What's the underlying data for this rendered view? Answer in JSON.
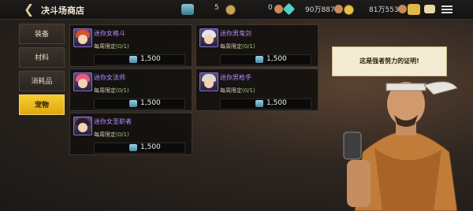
{
  "header": {
    "title": "决斗场商店"
  },
  "currencies": [
    {
      "amount": "5",
      "icon": "ticket-icon"
    },
    {
      "amount": "0",
      "icon": "gear-coin-icon"
    },
    {
      "amount": "90万8874",
      "icon": "gem-icon"
    },
    {
      "amount": "81万5530",
      "icon": "gold-coin-icon"
    }
  ],
  "sidebar": {
    "items": [
      {
        "label": "装备"
      },
      {
        "label": "材料"
      },
      {
        "label": "消耗品"
      },
      {
        "label": "宠物"
      }
    ],
    "active": 3
  },
  "items": [
    {
      "name": "迷你女格斗",
      "limit_label": "每周限定",
      "limit": "(0/1)",
      "price": "1,500",
      "hair_color": "#d8522a"
    },
    {
      "name": "迷你男鬼剑",
      "limit_label": "每周限定",
      "limit": "(0/1)",
      "price": "1,500",
      "hair_color": "#e4e4ec"
    },
    {
      "name": "迷你女法师",
      "limit_label": "每周限定",
      "limit": "(0/1)",
      "price": "1,500",
      "hair_color": "#e85a78"
    },
    {
      "name": "迷你男枪手",
      "limit_label": "每周限定",
      "limit": "(0/1)",
      "price": "1,500",
      "hair_color": "#d8d8d0"
    },
    {
      "name": "迷你女圣职者",
      "limit_label": "每周限定",
      "limit": "(0/1)",
      "price": "1,500",
      "hair_color": "#2a1e2a"
    }
  ],
  "npc": {
    "speech": "这是强者努力的证明!"
  }
}
